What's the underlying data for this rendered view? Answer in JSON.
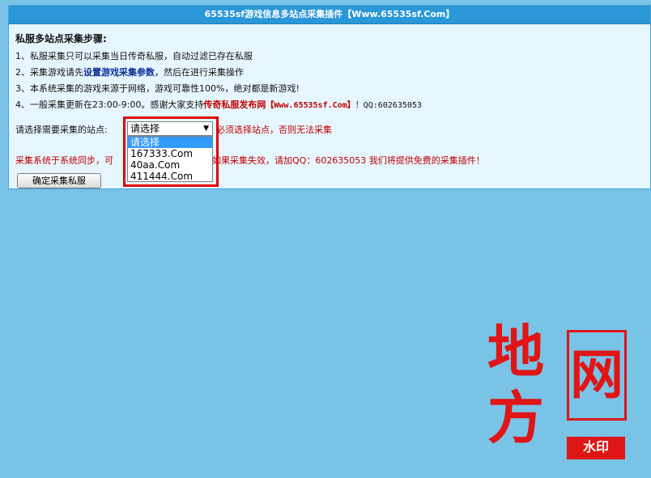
{
  "window": {
    "title": "65535sf游戏信息多站点采集插件【Www.65535sf.Com】"
  },
  "instructions": {
    "heading": "私服多站点采集步骤:",
    "step1": "1、私服采集只可以采集当日传奇私服，自动过滤已存在私服",
    "step2_prefix": "2、采集游戏请先",
    "step2_link": "设置游戏采集参数",
    "step2_suffix": "，然后在进行采集操作",
    "step3": "3、本系统采集的游戏来源于网络，游戏可靠性100%，绝对都是新游戏!",
    "step4_prefix": "4、一般采集更新在23:00-9:00。感谢大家支持",
    "step4_link": "传奇私服发布网",
    "step4_site": "【Www.65535sf.Com】",
    "step4_suffix": "！QQ:602635053"
  },
  "site_select": {
    "label": "请选择需要采集的站点:",
    "selected": "请选择",
    "warning": "必须选择站点，否则无法采集",
    "options": [
      "请选择",
      "167333.Com",
      "40aa.Com",
      "411444.Com"
    ]
  },
  "notice": {
    "text_left": "采集系统于系统同步，可",
    "text_right": "制！如果采集失效，请加QQ：602635053 我们将提供免费的采集插件！"
  },
  "buttons": {
    "confirm_label": "确定采集私服"
  },
  "watermark": {
    "char1": "地",
    "char2": "网",
    "char3": "方",
    "stamp": "水印"
  },
  "colors": {
    "background": "#79c3e7",
    "titlebar": "#2a97d8",
    "warning_red": "#c00000",
    "highlight_red": "#e00000",
    "link_blue": "#0b2d9b"
  }
}
